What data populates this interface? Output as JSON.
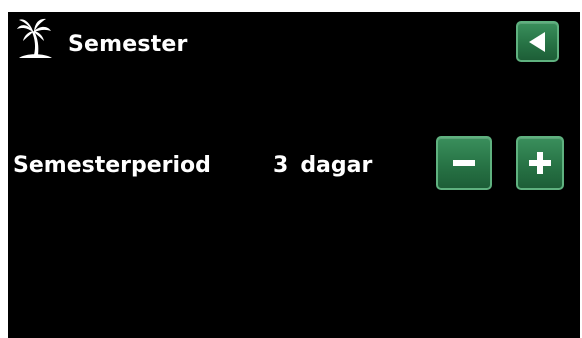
{
  "screen": {
    "title": "Semester",
    "title_icon": "palm-tree-icon",
    "back_icon": "back-arrow-icon"
  },
  "setting": {
    "label": "Semesterperiod",
    "value": "3",
    "unit": "dagar",
    "decrement_icon": "minus-icon",
    "increment_icon": "plus-icon"
  },
  "colors": {
    "background": "#000000",
    "text": "#ffffff",
    "button_green": "#277345",
    "button_border": "#5fb17f"
  }
}
